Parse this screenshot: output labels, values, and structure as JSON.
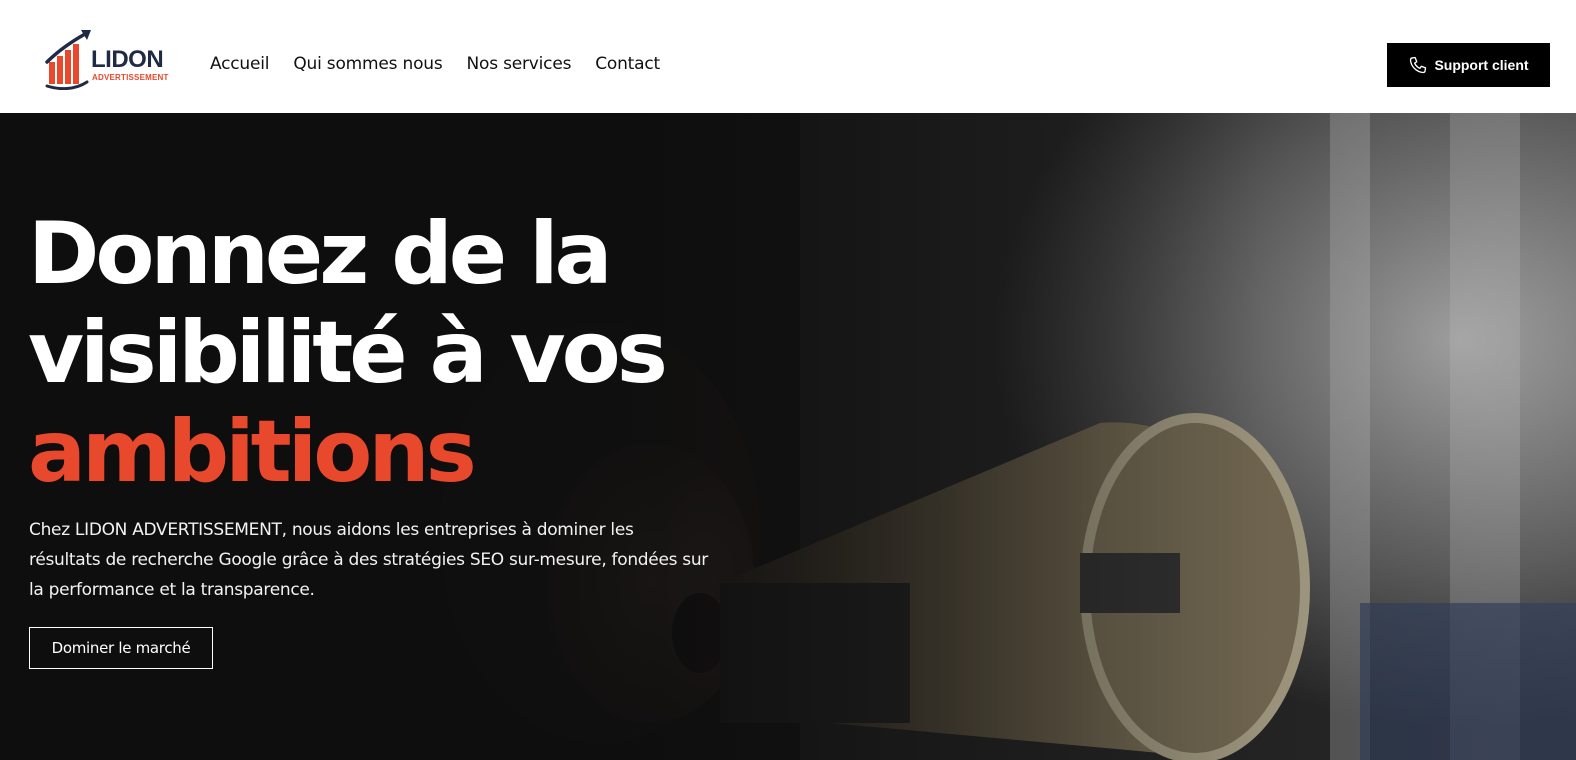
{
  "brand": {
    "name": "LIDON",
    "tagline": "ADVERTISSEMENT",
    "colors": {
      "dark": "#1f2a44",
      "accent": "#e8482c"
    }
  },
  "nav": {
    "items": [
      {
        "label": "Accueil"
      },
      {
        "label": "Qui sommes nous"
      },
      {
        "label": "Nos services"
      },
      {
        "label": "Contact"
      }
    ]
  },
  "header": {
    "support_label": "Support client",
    "support_icon": "phone-icon"
  },
  "hero": {
    "title_line1": "Donnez de la",
    "title_line2": "visibilité à vos",
    "title_accent": "ambitions",
    "description": "Chez LIDON ADVERTISSEMENT, nous aidons les entreprises à dominer les résultats de recherche Google grâce à des stratégies SEO sur-mesure, fondées sur la performance et la transparence.",
    "cta_label": "Dominer le marché",
    "accent_color": "#e8482c"
  }
}
